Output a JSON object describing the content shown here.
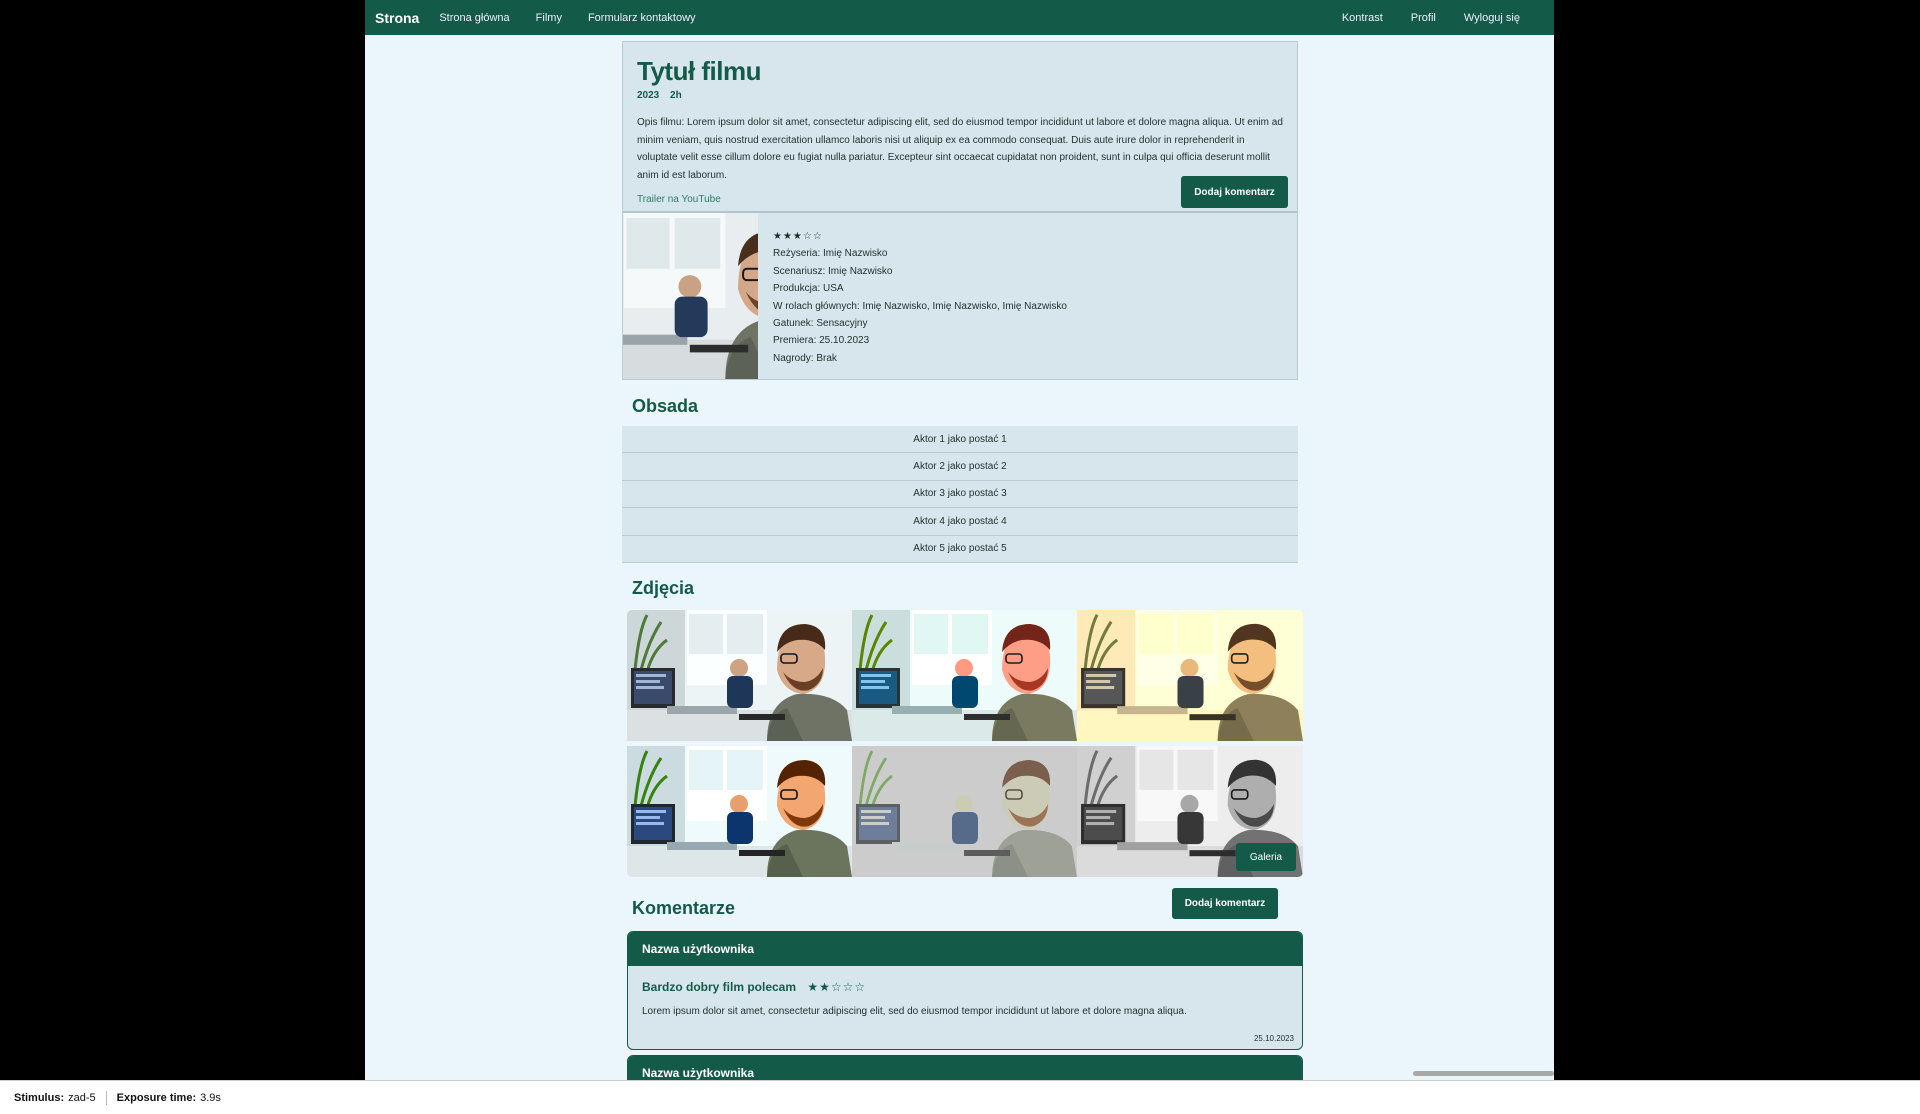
{
  "navbar": {
    "brand": "Strona",
    "links": [
      "Strona główna",
      "Filmy",
      "Formularz kontaktowy"
    ],
    "right_links": [
      "Kontrast",
      "Profil",
      "Wyloguj się"
    ]
  },
  "movie": {
    "title": "Tytuł filmu",
    "year": "2023",
    "duration": "2h",
    "description": "Opis filmu: Lorem ipsum dolor sit amet, consectetur adipiscing elit, sed do eiusmod tempor incididunt ut labore et dolore magna aliqua. Ut enim ad minim veniam, quis nostrud exercitation ullamco laboris nisi ut aliquip ex ea commodo consequat. Duis aute irure dolor in reprehenderit in voluptate velit esse cillum dolore eu fugiat nulla pariatur. Excepteur sint occaecat cupidatat non proident, sunt in culpa qui officia deserunt mollit anim id est laborum.",
    "trailer": "Trailer na YouTube",
    "add_comment": "Dodaj komentarz",
    "rating_stars": "★★★☆☆",
    "rating": 3,
    "details": {
      "director": "Reżyseria: Imię Nazwisko",
      "writer": "Scenariusz: Imię Nazwisko",
      "production": "Produkcja: USA",
      "cast": "W rolach głównych: Imię Nazwisko, Imię Nazwisko, Imię Nazwisko",
      "genre": "Gatunek: Sensacyjny",
      "premiere": "Premiera: 25.10.2023",
      "awards": "Nagrody: Brak"
    }
  },
  "cast_section": {
    "title": "Obsada",
    "items": [
      "Aktor 1 jako postać 1",
      "Aktor 2 jako postać 2",
      "Aktor 3 jako postać 3",
      "Aktor 4 jako postać 4",
      "Aktor 5 jako postać 5"
    ]
  },
  "photos_section": {
    "title": "Zdjęcia",
    "gallery_button": "Galeria"
  },
  "comments_section": {
    "title": "Komentarze",
    "add_comment": "Dodaj komentarz",
    "comments": [
      {
        "user": "Nazwa użytkownika",
        "title": "Bardzo dobry film polecam",
        "stars": "★★☆☆☆",
        "rating": 2,
        "text": "Lorem ipsum dolor sit amet, consectetur adipiscing elit, sed do eiusmod tempor incididunt ut labore et dolore magna aliqua.",
        "date": "25.10.2023"
      },
      {
        "user": "Nazwa użytkownika"
      }
    ]
  },
  "status_bar": {
    "stimulus_label": "Stimulus:",
    "stimulus_value": "zad-5",
    "exposure_label": "Exposure time:",
    "exposure_value": "3.9s"
  },
  "colors": {
    "primary": "#145a49",
    "background": "#eaf6fc",
    "card": "#d6e6ec"
  }
}
